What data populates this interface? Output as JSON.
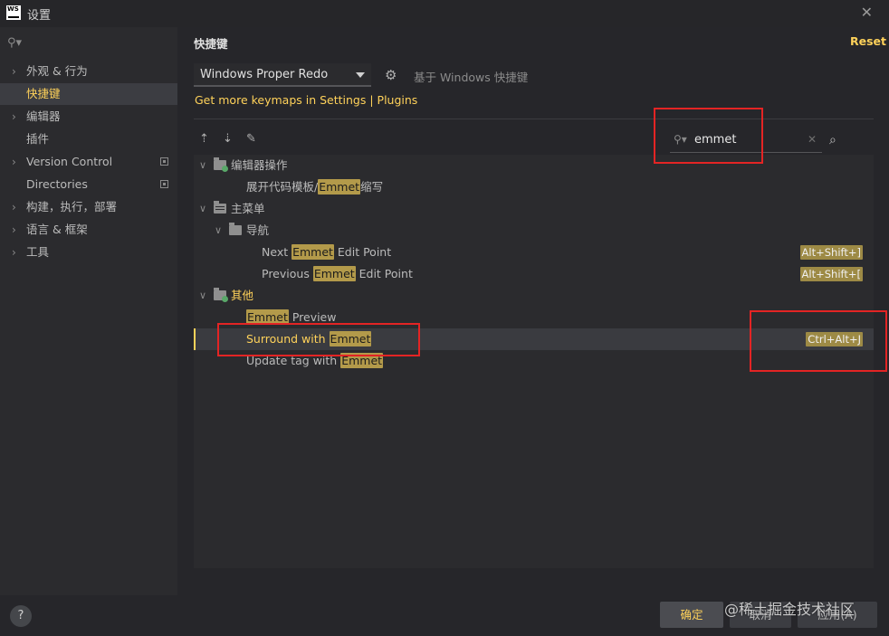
{
  "window": {
    "logo": "WS",
    "title": "设置",
    "close": "✕"
  },
  "sidebar": {
    "search_icon": "search-icon",
    "items": [
      {
        "label": "外观 & 行为",
        "expandable": true
      },
      {
        "label": "快捷键",
        "selected": true
      },
      {
        "label": "编辑器",
        "expandable": true
      },
      {
        "label": "插件"
      },
      {
        "label": "Version Control",
        "expandable": true,
        "project_icon": true
      },
      {
        "label": "Directories",
        "project_icon": true
      },
      {
        "label": "构建，执行，部署",
        "expandable": true
      },
      {
        "label": "语言 & 框架",
        "expandable": true
      },
      {
        "label": "工具",
        "expandable": true
      }
    ]
  },
  "header": {
    "title": "快捷键",
    "reset_label": "Reset"
  },
  "keymap": {
    "selected": "Windows Proper Redo",
    "based_on": "基于 Windows 快捷键",
    "more_link": "Get more keymaps in Settings | Plugins"
  },
  "search": {
    "value": "emmet",
    "clear": "✕"
  },
  "tree": {
    "cat1": {
      "label": "编辑器操作"
    },
    "item1": {
      "pre": "展开代码模板/",
      "hl": "Emmet",
      "post": "缩写"
    },
    "cat2": {
      "label": "主菜单"
    },
    "sub1": {
      "label": "导航"
    },
    "item2": {
      "pre": "Next ",
      "hl": "Emmet",
      "post": " Edit Point",
      "shortcut": "Alt+Shift+]"
    },
    "item3": {
      "pre": "Previous ",
      "hl": "Emmet",
      "post": " Edit Point",
      "shortcut": "Alt+Shift+["
    },
    "cat3": {
      "label": "其他"
    },
    "item4": {
      "pre": "",
      "hl": "Emmet",
      "post": " Preview"
    },
    "item5": {
      "pre": "Surround with ",
      "hl": "Emmet",
      "post": "",
      "shortcut": "Ctrl+Alt+J"
    },
    "item6": {
      "pre": "Update tag with ",
      "hl": "Emmet",
      "post": ""
    }
  },
  "footer": {
    "help": "?",
    "ok": "确定",
    "cancel": "取消",
    "apply": "应用(A)",
    "watermark": "@稀土掘金技术社区"
  }
}
